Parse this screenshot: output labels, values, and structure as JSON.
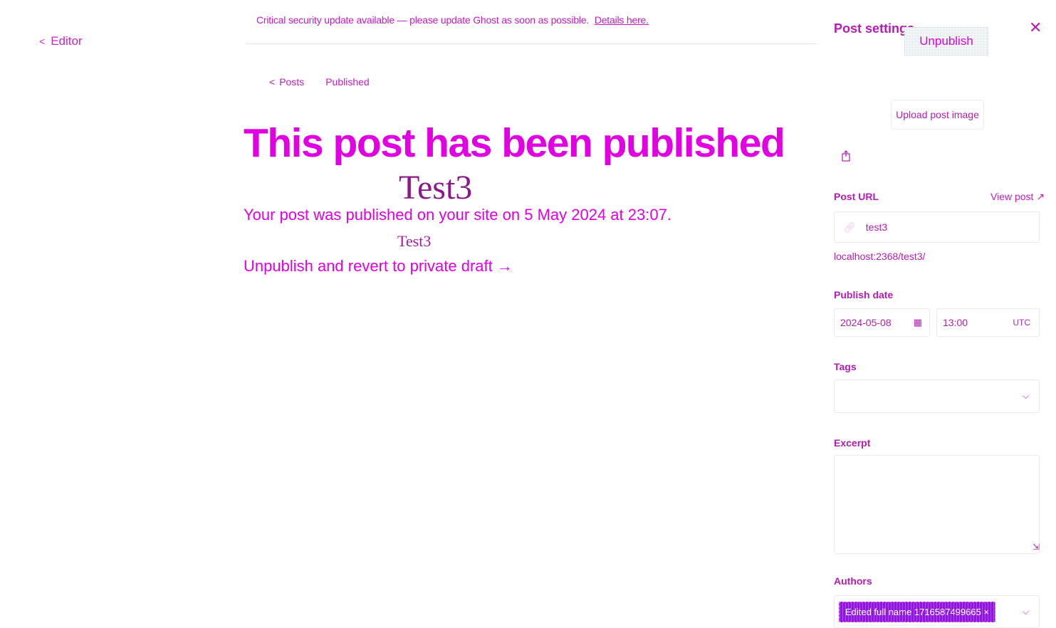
{
  "nav": {
    "back_label": "Editor",
    "back_icon": "chevron-left-icon"
  },
  "banner": {
    "text": "Critical security update available — please update Ghost as soon as possible.",
    "link": "Details here."
  },
  "breadcrumb": {
    "parent": "Posts",
    "current": "Published"
  },
  "hero": {
    "title": "This post has been published",
    "post_name": "Test3",
    "subtitle": "Your post was published on your site on 5 May 2024 at 23:07.",
    "post_name_small": "Test3",
    "unpublish_link": "Unpublish and revert to private draft →"
  },
  "settings": {
    "title": "Post settings",
    "unpublish_button": "Unpublish",
    "close_icon": "close-icon",
    "upload_image": "Upload post image",
    "post_url_label": "Post URL",
    "view_post": "View post ↗",
    "slug": "test3",
    "url_hint": "localhost:2368/test3/",
    "publish_date_label": "Publish date",
    "date_value": "2024-05-08",
    "time_value": "13:00",
    "timezone": "UTC",
    "tags_label": "Tags",
    "excerpt_label": "Excerpt",
    "authors_label": "Authors",
    "author_chip": "Edited full name 1716587499665 ×"
  },
  "colors": {
    "accent": "#e100e1",
    "muted": "#b51cb5",
    "author_chip": "#8e18d8"
  }
}
